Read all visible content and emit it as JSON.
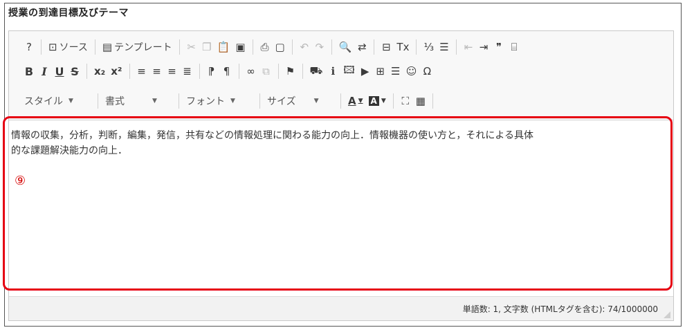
{
  "form": {
    "title": "授業の到達目標及びテーマ"
  },
  "toolbar": {
    "row1": [
      {
        "icon": "help-icon",
        "glyph": "?",
        "label": ""
      },
      {
        "sep": true
      },
      {
        "icon": "source-icon",
        "glyph": "⊡",
        "label": "ソース"
      },
      {
        "sep": true
      },
      {
        "icon": "template-icon",
        "glyph": "▤",
        "label": "テンプレート"
      },
      {
        "sep": true
      },
      {
        "icon": "cut-icon",
        "glyph": "✂",
        "label": "",
        "disabled": true
      },
      {
        "icon": "copy-icon",
        "glyph": "❐",
        "label": "",
        "disabled": true
      },
      {
        "icon": "paste-icon",
        "glyph": "📋",
        "label": ""
      },
      {
        "icon": "paste-text-icon",
        "glyph": "▣",
        "label": ""
      },
      {
        "sep": true
      },
      {
        "icon": "print-icon",
        "glyph": "⎙",
        "label": ""
      },
      {
        "icon": "preview-icon",
        "glyph": "▢",
        "label": ""
      },
      {
        "sep": true
      },
      {
        "icon": "undo-icon",
        "glyph": "↶",
        "label": "",
        "disabled": true
      },
      {
        "icon": "redo-icon",
        "glyph": "↷",
        "label": "",
        "disabled": true
      },
      {
        "sep": true
      },
      {
        "icon": "find-icon",
        "glyph": "🔍",
        "label": ""
      },
      {
        "icon": "replace-icon",
        "glyph": "⇄",
        "label": ""
      },
      {
        "sep": true
      },
      {
        "icon": "page-break-icon",
        "glyph": "⊟",
        "label": ""
      },
      {
        "icon": "remove-format-icon",
        "glyph": "Tx",
        "label": ""
      },
      {
        "sep": true
      },
      {
        "icon": "numbered-list-icon",
        "glyph": "⅓",
        "label": ""
      },
      {
        "icon": "bulleted-list-icon",
        "glyph": "☰",
        "label": ""
      },
      {
        "sep": true
      },
      {
        "icon": "outdent-icon",
        "glyph": "⇤",
        "label": "",
        "disabled": true
      },
      {
        "icon": "indent-icon",
        "glyph": "⇥",
        "label": ""
      },
      {
        "icon": "blockquote-icon",
        "glyph": "❞",
        "label": ""
      },
      {
        "icon": "div-icon",
        "glyph": "⌸",
        "label": ""
      }
    ],
    "row2": [
      {
        "icon": "bold-icon",
        "glyph": "B",
        "cls": "bold"
      },
      {
        "icon": "italic-icon",
        "glyph": "I",
        "cls": "ital"
      },
      {
        "icon": "underline-icon",
        "glyph": "U",
        "cls": "und"
      },
      {
        "icon": "strikethrough-icon",
        "glyph": "S",
        "cls": "strike"
      },
      {
        "sep": true
      },
      {
        "icon": "subscript-icon",
        "glyph": "x₂",
        "cls": "sub"
      },
      {
        "icon": "superscript-icon",
        "glyph": "x²",
        "cls": "sup"
      },
      {
        "sep": true
      },
      {
        "icon": "align-left-icon",
        "glyph": "≡"
      },
      {
        "icon": "align-center-icon",
        "glyph": "≡"
      },
      {
        "icon": "align-right-icon",
        "glyph": "≡"
      },
      {
        "icon": "align-justify-icon",
        "glyph": "≣"
      },
      {
        "sep": true
      },
      {
        "icon": "ltr-icon",
        "glyph": "⁋"
      },
      {
        "icon": "rtl-icon",
        "glyph": "¶"
      },
      {
        "sep": true
      },
      {
        "icon": "link-icon",
        "glyph": "∞"
      },
      {
        "icon": "unlink-icon",
        "glyph": "⧉",
        "disabled": true
      },
      {
        "sep": true
      },
      {
        "icon": "anchor-icon",
        "glyph": "⚑"
      },
      {
        "sep": true
      },
      {
        "icon": "cart-icon",
        "glyph": "⛟"
      },
      {
        "icon": "info-icon",
        "glyph": "ℹ"
      },
      {
        "icon": "image-icon",
        "glyph": "🖾"
      },
      {
        "icon": "video-icon",
        "glyph": "▶"
      },
      {
        "icon": "table-icon",
        "glyph": "⊞"
      },
      {
        "icon": "horizontal-rule-icon",
        "glyph": "☰"
      },
      {
        "icon": "smiley-icon",
        "glyph": "☺"
      },
      {
        "icon": "special-char-icon",
        "glyph": "Ω"
      }
    ],
    "row3": {
      "combos": [
        {
          "name": "style-combo",
          "label": "スタイル"
        },
        {
          "name": "format-combo",
          "label": "書式"
        },
        {
          "name": "font-combo",
          "label": "フォント"
        },
        {
          "name": "size-combo",
          "label": "サイズ"
        }
      ],
      "text_color_glyph": "A",
      "bg_color_glyph": "A",
      "maximize_glyph": "⛶",
      "show_blocks_glyph": "▦"
    }
  },
  "content": {
    "line1": "情報の収集，分析，判断，編集，発信，共有などの情報処理に関わる能力の向上．情報機器の使い方と，それによる具体",
    "line2": "的な課題解決能力の向上．",
    "marker": "⑨"
  },
  "status": {
    "count": "単語数: 1, 文字数 (HTMLタグを含む): 74/1000000"
  },
  "colors": {
    "highlight": "#e60012",
    "marker": "#d40000"
  }
}
